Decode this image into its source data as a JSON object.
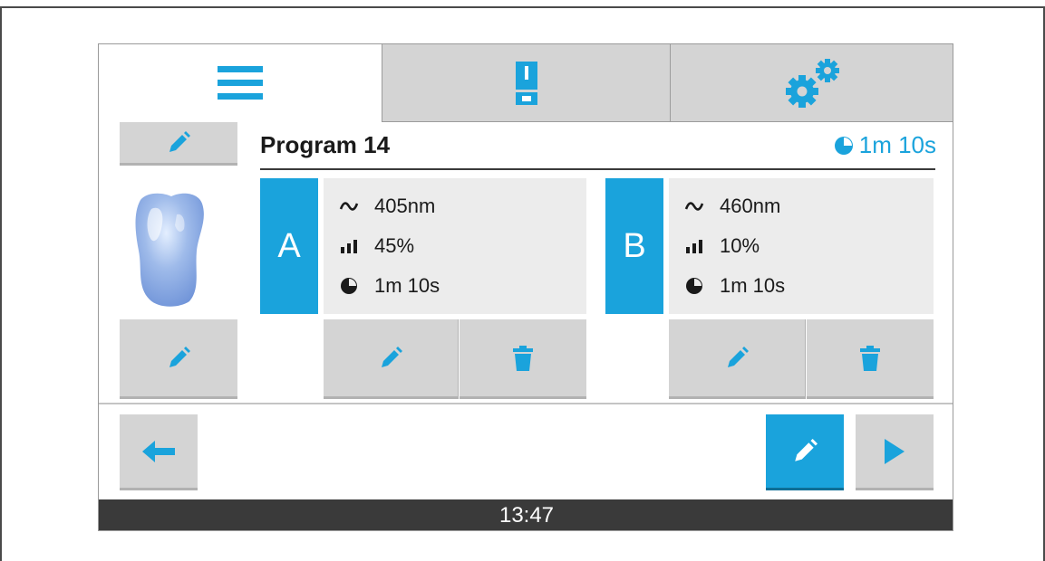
{
  "tabs": [
    {
      "id": "program",
      "icon": "menu-icon",
      "active": true
    },
    {
      "id": "device",
      "icon": "device-icon",
      "active": false
    },
    {
      "id": "settings",
      "icon": "gears-icon",
      "active": false
    }
  ],
  "program": {
    "title": "Program 14",
    "total_time": "1m 10s"
  },
  "channels": [
    {
      "letter": "A",
      "wavelength": "405nm",
      "intensity": "45%",
      "duration": "1m 10s"
    },
    {
      "letter": "B",
      "wavelength": "460nm",
      "intensity": "10%",
      "duration": "1m 10s"
    }
  ],
  "icons": {
    "edit": "pencil-icon",
    "delete": "trash-icon",
    "back": "arrow-left-icon",
    "next": "play-icon",
    "wave": "wave-icon",
    "intensity": "signal-bars-icon",
    "timer": "clock-icon"
  },
  "colors": {
    "accent": "#1aa3dc",
    "button_bg": "#d4d4d4",
    "status_bar": "#3a3a3a"
  },
  "status_bar": {
    "time": "13:47"
  }
}
